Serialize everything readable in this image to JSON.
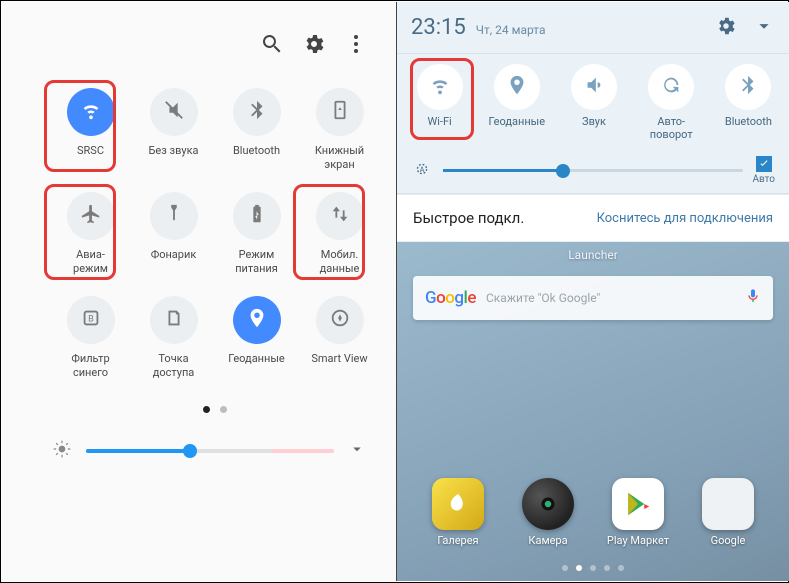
{
  "left": {
    "tiles": [
      {
        "label": "SRSC",
        "active": true
      },
      {
        "label": "Без звука"
      },
      {
        "label": "Bluetooth"
      },
      {
        "label": "Книжный\nэкран"
      },
      {
        "label": "Авиа-\nрежим"
      },
      {
        "label": "Фонарик"
      },
      {
        "label": "Режим\nпитания"
      },
      {
        "label": "Мобил.\nданные"
      },
      {
        "label": "Фильтр\nсинего"
      },
      {
        "label": "Точка\nдоступа"
      },
      {
        "label": "Геоданные",
        "active": true
      },
      {
        "label": "Smart View"
      }
    ]
  },
  "right": {
    "time": "23:15",
    "date": "Чт, 24 марта",
    "tiles": [
      {
        "label": "Wi-Fi"
      },
      {
        "label": "Геоданные"
      },
      {
        "label": "Звук"
      },
      {
        "label": "Авто-\nповорот"
      },
      {
        "label": "Bluetooth"
      }
    ],
    "auto_label": "Авто",
    "quick_connect": "Быстрое подкл.",
    "quick_connect_hint": "Коснитесь для подключения",
    "launcher": "Launcher",
    "search_placeholder": "Скажите \"Ok Google\"",
    "apps": [
      {
        "name": "Галерея"
      },
      {
        "name": "Камера"
      },
      {
        "name": "Play Маркет"
      },
      {
        "name": "Google"
      }
    ]
  }
}
